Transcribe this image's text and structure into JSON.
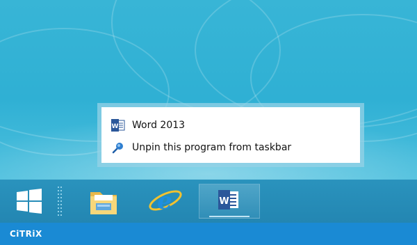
{
  "jumplist": {
    "items": [
      {
        "label": "Word 2013",
        "icon": "word-icon"
      },
      {
        "label": "Unpin this program from taskbar",
        "icon": "unpin-icon"
      }
    ]
  },
  "taskbar": {
    "buttons": [
      {
        "name": "start-button",
        "icon": "windows-logo-icon"
      },
      {
        "name": "file-explorer-button",
        "icon": "folder-icon"
      },
      {
        "name": "internet-explorer-button",
        "icon": "internet-explorer-icon"
      },
      {
        "name": "word-button",
        "icon": "word-icon",
        "active": true
      }
    ]
  },
  "citrix": {
    "logo_text": "CiTRiX"
  },
  "colors": {
    "desktop": "#2fb0d4",
    "taskbar": "#2386b2",
    "citrix_bar": "#1a8ad4",
    "word_blue": "#2b579a"
  }
}
